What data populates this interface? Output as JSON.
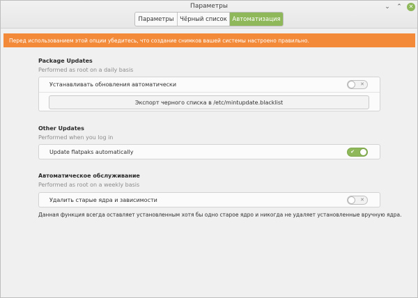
{
  "window": {
    "title": "Параметры",
    "controls": {
      "minimize": "⌄",
      "maximize": "⌃",
      "close": "✕"
    }
  },
  "tabs": [
    {
      "label": "Параметры",
      "active": false
    },
    {
      "label": "Чёрный список",
      "active": false
    },
    {
      "label": "Автоматизация",
      "active": true
    }
  ],
  "warning": {
    "text": "Перед использованием этой опции убедитесь, что создание снимков вашей системы настроено правильно."
  },
  "sections": {
    "package_updates": {
      "title": "Package Updates",
      "subtitle": "Performed as root on a daily basis",
      "toggle_label": "Устанавливать обновления автоматически",
      "toggle_state": "off",
      "export_button": "Экспорт черного списка в /etc/mintupdate.blacklist"
    },
    "other_updates": {
      "title": "Other Updates",
      "subtitle": "Performed when you log in",
      "toggle_label": "Update flatpaks automatically",
      "toggle_state": "on"
    },
    "maintenance": {
      "title": "Автоматическое обслуживание",
      "subtitle": "Performed as root on a weekly basis",
      "toggle_label": "Удалить старые ядра и зависимости",
      "toggle_state": "off",
      "note": "Данная функция всегда оставляет установленным хотя бы одно старое ядро и никогда не удаляет установленные вручную ядра."
    }
  },
  "switch_marks": {
    "on": "✔",
    "off": "✕"
  },
  "colors": {
    "accent": "#8fb85a",
    "warning": "#f28a3a",
    "background": "#f0f0f0"
  }
}
